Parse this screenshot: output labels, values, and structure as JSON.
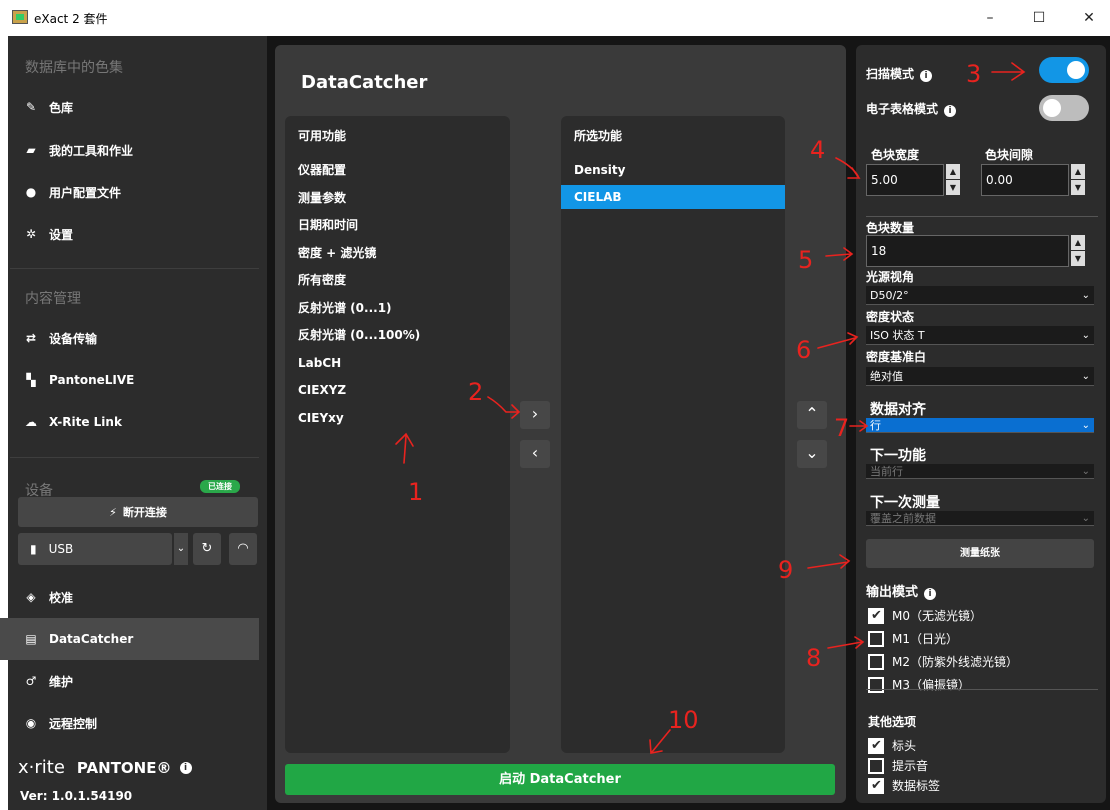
{
  "window": {
    "title": "eXact 2 套件",
    "minimize": "–",
    "maximize": "☐",
    "close": "✕"
  },
  "sidebar": {
    "section_colorsets": "数据库中的色集",
    "items_top": [
      {
        "label": "色库",
        "icon": "swatch-icon"
      },
      {
        "label": "我的工具和作业",
        "icon": "folder-icon"
      },
      {
        "label": "用户配置文件",
        "icon": "user-icon"
      },
      {
        "label": "设置",
        "icon": "gear-icon"
      }
    ],
    "section_content": "内容管理",
    "items_content": [
      {
        "label": "设备传输",
        "icon": "transfer-icon"
      },
      {
        "label": "PantoneLIVE",
        "icon": "pantone-icon"
      },
      {
        "label": "X-Rite Link",
        "icon": "cloud-icon"
      }
    ],
    "section_device": "设备",
    "badge": "已连接",
    "disconnect": "断开连接",
    "usb": "USB",
    "items_device": [
      {
        "label": "校准",
        "icon": "target-icon"
      },
      {
        "label": "DataCatcher",
        "icon": "datacatcher-icon"
      },
      {
        "label": "维护",
        "icon": "wrench-icon"
      },
      {
        "label": "远程控制",
        "icon": "remote-icon"
      }
    ],
    "brand_xrite": "x·rite",
    "brand_pantone": "PANTONE®",
    "version": "Ver: 1.0.1.54190"
  },
  "main": {
    "title": "DataCatcher",
    "available_header": "可用功能",
    "available": [
      "仪器配置",
      "测量参数",
      "日期和时间",
      "密度 + 滤光镜",
      "所有密度",
      "反射光谱 (0...1)",
      "反射光谱 (0...100%)",
      "LabCH",
      "CIEXYZ",
      "CIEYxy"
    ],
    "selected_header": "所选功能",
    "selected": [
      "Density",
      "CIELAB"
    ],
    "selected_active_index": 1,
    "start": "启动 DataCatcher"
  },
  "right": {
    "scan_mode": "扫描模式",
    "scan_mode_on": true,
    "sheet_mode": "电子表格模式",
    "sheet_mode_on": false,
    "patch_width": "色块宽度",
    "patch_width_value": "5.00",
    "patch_gap": "色块间隙",
    "patch_gap_value": "0.00",
    "patch_count": "色块数量",
    "patch_count_value": "18",
    "illuminant": "光源视角",
    "illuminant_value": "D50/2°",
    "density_status": "密度状态",
    "density_status_value": "ISO 状态 T",
    "density_white": "密度基准白",
    "density_white_value": "绝对值",
    "data_align": "数据对齐",
    "data_align_value": "行",
    "next_function": "下一功能",
    "next_function_value": "当前行",
    "next_measure": "下一次测量",
    "next_measure_value": "覆盖之前数据",
    "measure_paper": "测量纸张",
    "output_mode": "输出模式",
    "modes": [
      {
        "label": "M0（无滤光镜）",
        "checked": true
      },
      {
        "label": "M1（日光）",
        "checked": false
      },
      {
        "label": "M2（防紫外线滤光镜）",
        "checked": false
      },
      {
        "label": "M3（偏振镜）",
        "checked": false
      }
    ],
    "other_options": "其他选项",
    "others": [
      {
        "label": "标头",
        "checked": true
      },
      {
        "label": "提示音",
        "checked": false
      },
      {
        "label": "数据标签",
        "checked": true
      }
    ],
    "toggle_on_color": "#1296e6",
    "toggle_off_color": "#bdbdbd"
  },
  "annotations": {
    "n1": "1",
    "n2": "2",
    "n3": "3",
    "n4": "4",
    "n5": "5",
    "n6": "6",
    "n7": "7",
    "n8": "8",
    "n9": "9",
    "n10": "10",
    "color": "#e8231f"
  }
}
